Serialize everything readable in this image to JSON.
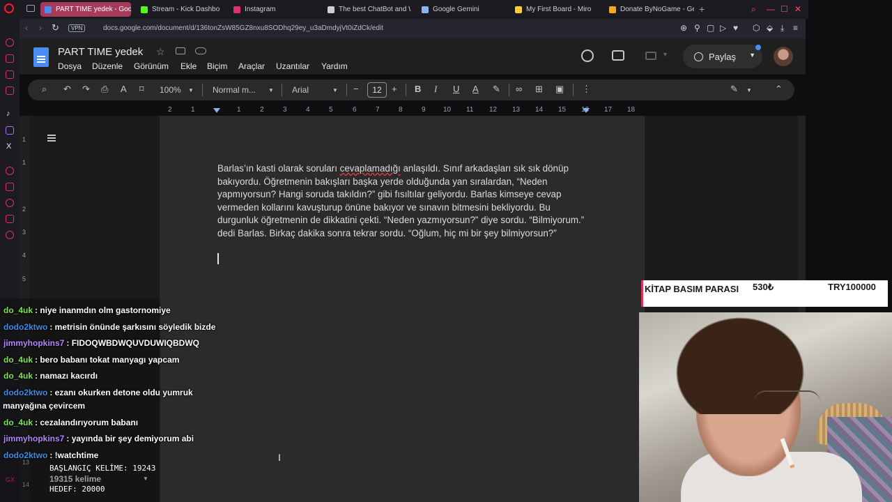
{
  "browser": {
    "tabs": [
      {
        "label": "PART TIME yedek - Goog",
        "active": true,
        "favicon": "docs-icon",
        "color": "#4b8ef3"
      },
      {
        "label": "Stream - Kick Dashbo",
        "active": false,
        "favicon": "kick-icon",
        "color": "#53fc18"
      },
      {
        "label": "Instagram",
        "active": false,
        "favicon": "instagram-icon",
        "color": "#e1306c"
      },
      {
        "label": "The best ChatBot and W",
        "active": false,
        "favicon": "chatbot-icon",
        "color": "#cfcfd6"
      },
      {
        "label": "Google Gemini",
        "active": false,
        "favicon": "gemini-icon",
        "color": "#8ab4f8"
      },
      {
        "label": "My First Board - Miro",
        "active": false,
        "favicon": "miro-icon",
        "color": "#ffd02f"
      },
      {
        "label": "Donate ByNoGame - Gele",
        "active": false,
        "favicon": "bynogame-icon",
        "color": "#f5a623"
      }
    ],
    "vpn": "VPN",
    "url": "docs.google.com/document/d/136tonZsW85GZ8nxu8SODhq29ey_u3aDmdyjVt0iZdCk/edit"
  },
  "docs": {
    "title": "PART TIME yedek",
    "menu": [
      "Dosya",
      "Düzenle",
      "Görünüm",
      "Ekle",
      "Biçim",
      "Araçlar",
      "Uzantılar",
      "Yardım"
    ],
    "share_label": "Paylaş",
    "toolbar": {
      "zoom": "100%",
      "style": "Normal m...",
      "font": "Arial",
      "font_size": "12"
    },
    "ruler_numbers": [
      "2",
      "1",
      "1",
      "2",
      "3",
      "4",
      "5",
      "6",
      "7",
      "8",
      "9",
      "10",
      "11",
      "12",
      "13",
      "14",
      "15",
      "16",
      "17",
      "18"
    ],
    "vertical_ruler": [
      "1",
      "1",
      "2",
      "3",
      "4",
      "5",
      "13",
      "14"
    ],
    "paragraph_before": "Barlas’ın kasti olarak soruları ",
    "paragraph_spell": "cevaplamadığı",
    "paragraph_after": " anlaşıldı. Sınıf arkadaşları sık sık dönüp bakıyordu. Öğretmenin bakışları başka yerde olduğunda yan sıralardan, “Neden yapmıyorsun? Hangi soruda takıldın?” gibi fısıltılar geliyordu. Barlas kimseye cevap vermeden kollarını kavuşturup önüne bakıyor ve sınavın bitmesini bekliyordu. Bu durgunluk öğretmenin de dikkatini çekti. “Neden yazmıyorsun?” diye sordu. “Bilmiyorum.” dedi Barlas. Birkaç dakika sonra tekrar sordu. “Oğlum, hiç mi bir şey bilmiyorsun?”"
  },
  "chat": {
    "messages": [
      {
        "user": "do_4uk",
        "color": "#7fe35a",
        "text": ": niye inanmdın olm gastornomiye"
      },
      {
        "user": "dodo2ktwo",
        "color": "#3f8ee8",
        "text": ": metrisin önünde şarkısını söyledik bizde"
      },
      {
        "user": "jimmyhopkins7",
        "color": "#b388ff",
        "text": ": FIDOQWBDWQUVDUWIQBDWQ"
      },
      {
        "user": "do_4uk",
        "color": "#7fe35a",
        "text": ": bero babanı tokat manyagı yapcam"
      },
      {
        "user": "do_4uk",
        "color": "#7fe35a",
        "text": ": namazı kacırdı"
      },
      {
        "user": "dodo2ktwo",
        "color": "#3f8ee8",
        "text": ": ezanı okurken detone oldu yumruk",
        "continuation": "manyağına çevircem"
      },
      {
        "user": "do_4uk",
        "color": "#7fe35a",
        "text": ": cezalandırıyorum babanı"
      },
      {
        "user": "jimmyhopkins7",
        "color": "#b388ff",
        "text": ": yayında bir şey demiyorum abi"
      },
      {
        "user": "dodo2ktwo",
        "color": "#3f8ee8",
        "text": ": !watchtime"
      }
    ]
  },
  "word_count": {
    "start": "BAŞLANGIÇ KELİME: 19243",
    "current": "19315 kelime",
    "goal": "HEDEF: 20000"
  },
  "book_widget": {
    "title": "KİTAP BASIM PARASI",
    "price": "530₺",
    "goal": "TRY100000"
  },
  "sidebar_badge": "GX"
}
